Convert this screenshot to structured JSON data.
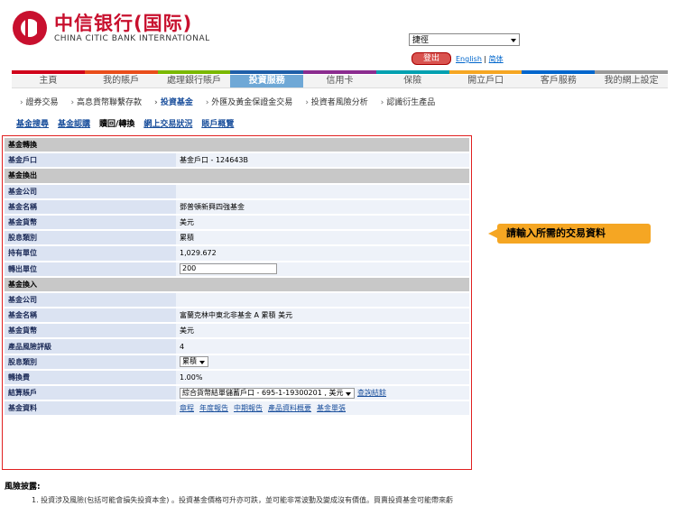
{
  "brand": {
    "name_zh": "中信银行(国际)",
    "name_en": "CHINA CITIC BANK INTERNATIONAL",
    "color": "#c8102e"
  },
  "header": {
    "quick_select": "捷徑",
    "logout_label": "登出",
    "lang_en": "English",
    "lang_simplified": "简体"
  },
  "main_nav": [
    "主頁",
    "我的賬戶",
    "處理銀行賬戶",
    "投資服務",
    "信用卡",
    "保險",
    "開立戶口",
    "客戶服務",
    "我的網上設定"
  ],
  "main_nav_active": 3,
  "nav_colors": [
    "#d0021b",
    "#e94e1b",
    "#7ab800",
    "#1f5fa8",
    "#8b2c8f",
    "#00a0b0",
    "#f5a623",
    "#0066cc",
    "#999999"
  ],
  "sub_nav": [
    "證券交易",
    "高息貨幣聯繫存款",
    "投資基金",
    "外匯及黃金保證金交易",
    "投資者風險分析",
    "認識衍生產品"
  ],
  "sub_nav_active": 2,
  "tabs": [
    "基金搜尋",
    "基金認購",
    "贖回/轉換",
    "網上交易狀況",
    "賬戶概覽"
  ],
  "tabs_active": 2,
  "form": {
    "sec_convert": "基金轉換",
    "fund_account_label": "基金戶口",
    "fund_account_value": "基金戶口 - 124643B",
    "sec_out": "基金換出",
    "out_company_label": "基金公司",
    "out_company_value": "",
    "out_name_label": "基金名稱",
    "out_name_value": "鄧普頓新興四強基金",
    "out_currency_label": "基金貨幣",
    "out_currency_value": "美元",
    "out_dividend_label": "股息類別",
    "out_dividend_value": "累積",
    "holding_label": "持有單位",
    "holding_value": "1,029.672",
    "units_out_label": "轉出單位",
    "units_out_value": "200",
    "sec_in": "基金換入",
    "in_company_label": "基金公司",
    "in_company_value": "",
    "in_name_label": "基金名稱",
    "in_name_value": "富蘭克林中東北非基金 A 累積 美元",
    "in_currency_label": "基金貨幣",
    "in_currency_value": "美元",
    "risk_label": "產品風險評級",
    "risk_value": "4",
    "in_dividend_label": "股息類別",
    "in_dividend_value": "累積",
    "fee_label": "轉換費",
    "fee_value": "1.00%",
    "settle_label": "結算賬戶",
    "settle_value": "綜合貨幣結單儲蓄戶口 - 695-1-19300201 , 美元",
    "settle_link": "查詢結餘",
    "docs_label": "基金資料",
    "docs": [
      "章程",
      "年度報告",
      "中期報告",
      "產品資料概要",
      "基金單張"
    ]
  },
  "callout": "請輸入所需的交易資料",
  "risk": {
    "title": "風險披露:",
    "item1": "1. 投資涉及風險(包括可能會損失投資本金) 。投資基金價格可升亦可跌，並可能非常波動及變成沒有價值。買賣投資基金可能帶來虧"
  }
}
